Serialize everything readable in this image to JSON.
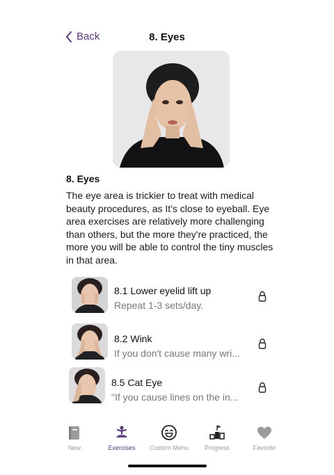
{
  "nav": {
    "back_label": "Back",
    "title": "8. Eyes"
  },
  "section": {
    "title": "8. Eyes",
    "description": "The eye area is trickier to treat with medical beauty procedures, as It's close to eyeball. Eye area exercises are relatively more challenging than others, but the more they're practiced, the more you will be able to control the tiny muscles in that area."
  },
  "exercises": [
    {
      "title": "8.1 Lower eyelid lift up",
      "subtitle": "Repeat 1-3 sets/day.",
      "locked": true
    },
    {
      "title": "8.2 Wink",
      "subtitle": "If you don't cause many wri...",
      "locked": true
    },
    {
      "title": "8.5 Cat Eye",
      "subtitle": "\"If you cause lines on the in...",
      "locked": true
    }
  ],
  "tabs": [
    {
      "label": "New",
      "icon": "book-icon",
      "active": false
    },
    {
      "label": "Exercises",
      "icon": "meditation-icon",
      "active": true
    },
    {
      "label": "Custom Menu",
      "icon": "smiley-icon",
      "active": false
    },
    {
      "label": "Progress",
      "icon": "podium-icon",
      "active": false
    },
    {
      "label": "Favorite",
      "icon": "heart-icon",
      "active": false
    }
  ],
  "colors": {
    "accent": "#5b3a78",
    "inactive": "#9a9a9a",
    "subtitle": "#777777"
  }
}
